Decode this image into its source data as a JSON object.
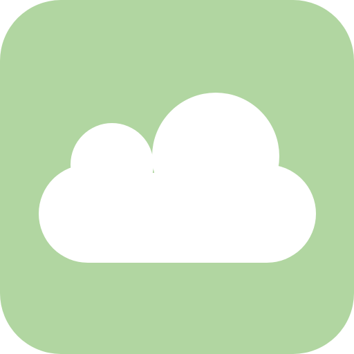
{
  "icon": {
    "name": "cloud-icon",
    "background_color": "#b1d6a1",
    "cloud_color": "#ffffff"
  }
}
